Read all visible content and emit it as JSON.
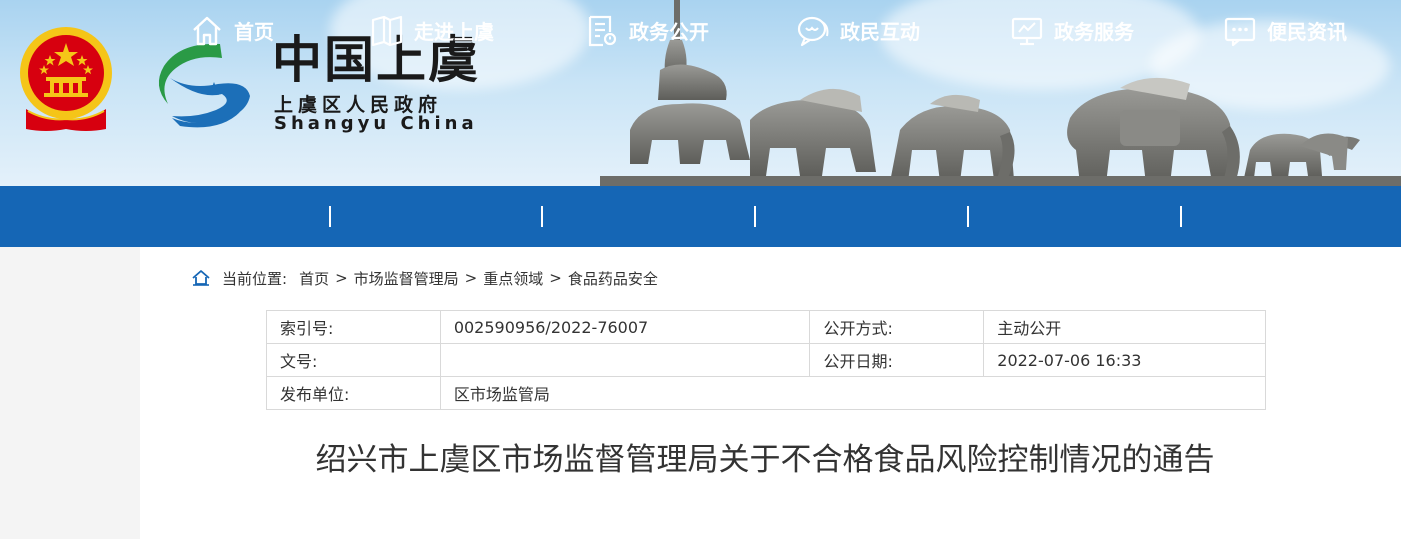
{
  "header": {
    "brand_title": "中国上虞",
    "brand_subtitle": "上虞区人民政府",
    "brand_english": "Shangyu  China"
  },
  "nav": {
    "items": [
      {
        "label": "首页",
        "icon": "home-icon"
      },
      {
        "label": "走进上虞",
        "icon": "book-icon"
      },
      {
        "label": "政务公开",
        "icon": "document-icon"
      },
      {
        "label": "政民互动",
        "icon": "chat-icon"
      },
      {
        "label": "政务服务",
        "icon": "monitor-icon"
      },
      {
        "label": "便民资讯",
        "icon": "message-icon"
      }
    ]
  },
  "breadcrumb": {
    "prefix": "当前位置:",
    "items": [
      "首页",
      "市场监督管理局",
      "重点领域",
      "食品药品安全"
    ]
  },
  "meta": {
    "index_label": "索引号:",
    "index_value": "002590956/2022-76007",
    "disclosure_mode_label": "公开方式:",
    "disclosure_mode_value": "主动公开",
    "doc_no_label": "文号:",
    "doc_no_value": "",
    "disclosure_date_label": "公开日期:",
    "disclosure_date_value": "2022-07-06 16:33",
    "publisher_label": "发布单位:",
    "publisher_value": "区市场监管局"
  },
  "article": {
    "title": "绍兴市上虞区市场监督管理局关于不合格食品风险控制情况的通告"
  },
  "colors": {
    "nav_bg": "#1566b5",
    "emblem_red": "#d7000f",
    "emblem_gold": "#f5c518",
    "logo_green": "#2a9a46",
    "logo_blue": "#1c6fb8"
  }
}
